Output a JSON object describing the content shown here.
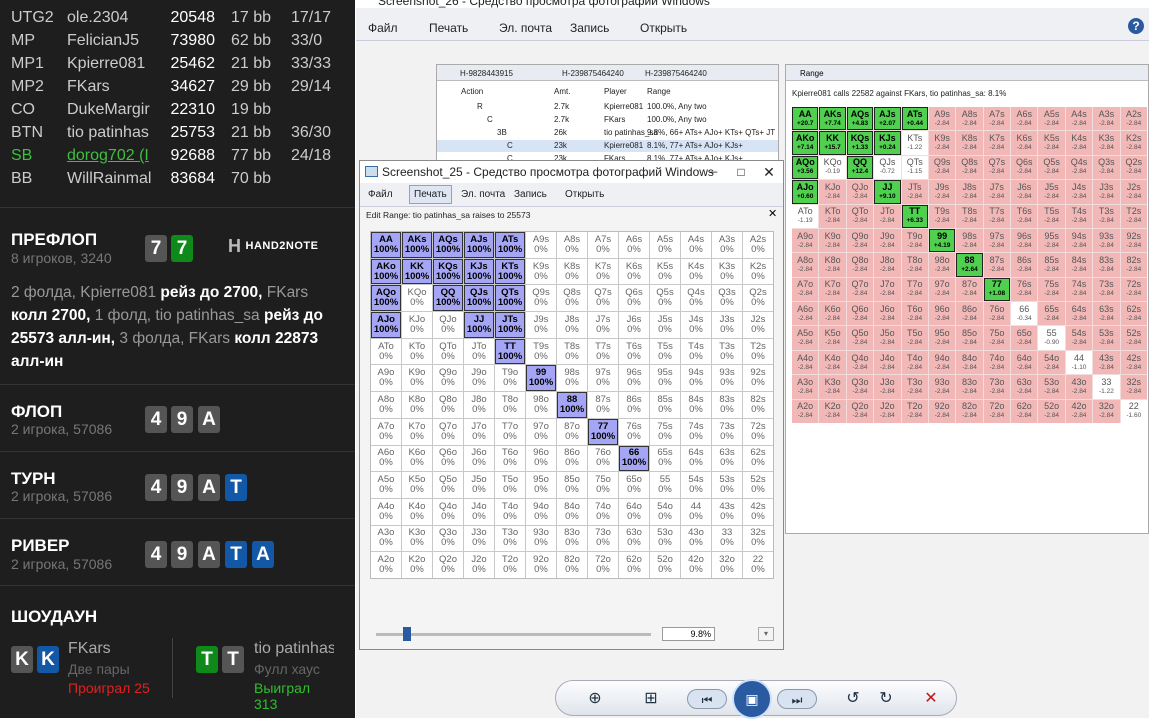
{
  "players": [
    {
      "pos": "UTG2",
      "name": "ole.2304",
      "stack": "20548",
      "bb": "17 bb",
      "hands": "17/17"
    },
    {
      "pos": "MP",
      "name": "FelicianJ5",
      "stack": "73980",
      "bb": "62 bb",
      "hands": "33/0"
    },
    {
      "pos": "MP1",
      "name": "Kpierre081",
      "stack": "25462",
      "bb": "21 bb",
      "hands": "33/33"
    },
    {
      "pos": "MP2",
      "name": "FKars",
      "stack": "34627",
      "bb": "29 bb",
      "hands": "29/14"
    },
    {
      "pos": "CO",
      "name": "DukeMargir",
      "stack": "22310",
      "bb": "19 bb",
      "hands": ""
    },
    {
      "pos": "BTN",
      "name": "tio patinhas",
      "stack": "25753",
      "bb": "21 bb",
      "hands": "36/30"
    },
    {
      "pos": "SB",
      "name": "dorog702 (I",
      "stack": "92688",
      "bb": "77 bb",
      "hands": "24/18"
    },
    {
      "pos": "BB",
      "name": "WillRainmal",
      "stack": "83684",
      "bb": "70 bb",
      "hands": ""
    }
  ],
  "preflop": {
    "title": "ПРЕФЛОП",
    "sub": "8 игроков, 3240",
    "cards": [
      "7",
      "7"
    ],
    "logo": "HAND2NOTE",
    "t1": "2 фолда, Kpierre081 ",
    "t2": "рейз до 2700,",
    "t3": " FKars",
    "t4": " колл 2700,",
    "t5": " 1 фолд, tio patinhas_sa ",
    "t6": "рейз до 25573 алл-ин,",
    "t7": " 3 фолда, FKars ",
    "t8": "колл 22873 алл-ин"
  },
  "flop": {
    "title": "ФЛОП",
    "sub": "2 игрока, 57086",
    "cards": [
      "4",
      "9",
      "A"
    ]
  },
  "turn": {
    "title": "ТУРН",
    "sub": "2 игрока, 57086",
    "cards": [
      "4",
      "9",
      "A",
      "T"
    ]
  },
  "river": {
    "title": "РИВЕР",
    "sub": "2 игрока, 57086",
    "cards": [
      "4",
      "9",
      "A",
      "T",
      "A"
    ]
  },
  "showdown": {
    "title": "ШОУДАУН",
    "p1": {
      "cards": [
        "K",
        "K"
      ],
      "name": "FKars",
      "hand": "Две пары",
      "result": "Проиграл 25"
    },
    "p2": {
      "cards": [
        "T",
        "T"
      ],
      "name": "tio patinhas",
      "hand": "Фулл хаус",
      "result": "Выиграл 313"
    }
  },
  "back_window": {
    "title": "Screenshot_26 - Средство просмотра фотографий Windows",
    "menu": [
      "Файл",
      "Печать",
      "Эл. почта",
      "Запись",
      "Открыть"
    ],
    "tabs": [
      "H-9828443915",
      "H-239875464240",
      "H-239875464240"
    ],
    "cols": [
      "Action",
      "Amt.",
      "Player",
      "Range"
    ],
    "rows": [
      [
        "R",
        "2.7k",
        "Kpierre081",
        "100.0%, Any two"
      ],
      [
        "C",
        "2.7k",
        "FKars",
        "100.0%, Any two"
      ],
      [
        "3B",
        "26k",
        "tio patinhas_sa",
        "9.8%, 66+ ATs+ AJo+ KTs+ QTs+ JT"
      ],
      [
        "C",
        "23k",
        "Kpierre081",
        "8.1%, 77+ ATs+ AJo+ KJs+"
      ],
      [
        "C",
        "23k",
        "FKars",
        "8.1%, 77+ ATs+ AJo+ KJs+"
      ]
    ],
    "range_tab": "Range",
    "range_title": "Kpierre081 calls 22582 against FKars, tio patinhas_sa: 8.1%"
  },
  "front_window": {
    "title": "Screenshot_25 - Средство просмотра фотографий Windows",
    "menu": [
      "Файл",
      "Печать",
      "Эл. почта",
      "Запись",
      "Открыть"
    ],
    "edit_title": "Edit Range: tio patinhas_sa raises to 25573",
    "percent": "9.8%",
    "selected_pct": "100%",
    "unselected_pct": "0%"
  },
  "ranks": [
    "A",
    "K",
    "Q",
    "J",
    "T",
    "9",
    "8",
    "7",
    "6",
    "5",
    "4",
    "3",
    "2"
  ],
  "front_selected": [
    "AA",
    "AKs",
    "AQs",
    "AJs",
    "ATs",
    "AKo",
    "KK",
    "KQs",
    "KJs",
    "KTs",
    "AQo",
    "QQ",
    "QJs",
    "QTs",
    "AJo",
    "JJ",
    "JTs",
    "TT",
    "99",
    "88",
    "77",
    "66"
  ],
  "back_selected": {
    "AA": "+20.7",
    "AKs": "+7.74",
    "AQs": "+4.83",
    "AJs": "+2.07",
    "ATs": "+0.44",
    "AKo": "+7.14",
    "KK": "+15.7",
    "KQs": "+1.33",
    "KJs": "+0.24",
    "AQo": "+3.56",
    "QQ": "+12.4",
    "AJo": "+0.60",
    "JJ": "+9.10",
    "TT": "+6.33",
    "99": "+4.19",
    "88": "+2.64",
    "77": "+1.08"
  },
  "back_small": {
    "QJs": "-0.72",
    "QTs": "-1.15",
    "KQo": "-0.19",
    "KTs": "-1.22",
    "ATo": "-1.19",
    "66": "-0.34",
    "55": "-0.90",
    "44": "-1.10",
    "33": "-1.22",
    "22": "-1.60"
  },
  "back_ev_text": "-2.84",
  "viewer": {
    "icons": [
      "zoom-icon",
      "fit-icon",
      "prev-icon",
      "slideshow-icon",
      "next-icon",
      "rotate-left-icon",
      "rotate-right-icon",
      "delete-icon"
    ]
  }
}
